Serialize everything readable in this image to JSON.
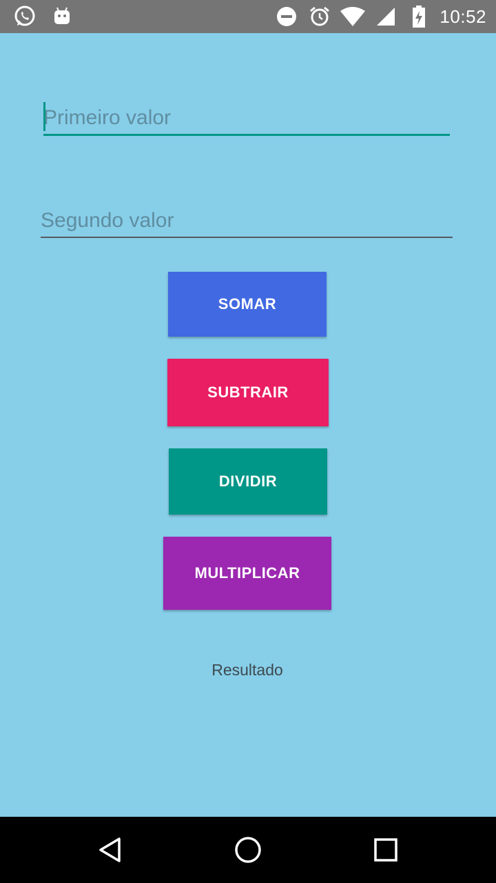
{
  "status_bar": {
    "time": "10:52",
    "icons": [
      "whatsapp-icon",
      "android-icon",
      "do-not-disturb-icon",
      "alarm-icon",
      "wifi-icon",
      "cell-signal-icon",
      "battery-charging-icon"
    ]
  },
  "form": {
    "first_value": {
      "value": "",
      "placeholder": "Primeiro valor"
    },
    "second_value": {
      "value": "",
      "placeholder": "Segundo valor"
    }
  },
  "buttons": {
    "add": "SOMAR",
    "subtract": "SUBTRAIR",
    "divide": "DIVIDIR",
    "multiply": "MULTIPLICAR"
  },
  "result": {
    "label": "Resultado"
  },
  "colors": {
    "background": "#87CEE9",
    "add": "#4169E1",
    "subtract": "#E91E63",
    "divide": "#009688",
    "multiply": "#9C27B0"
  },
  "nav_bar": {
    "icons": [
      "back-icon",
      "home-icon",
      "recents-icon"
    ]
  }
}
